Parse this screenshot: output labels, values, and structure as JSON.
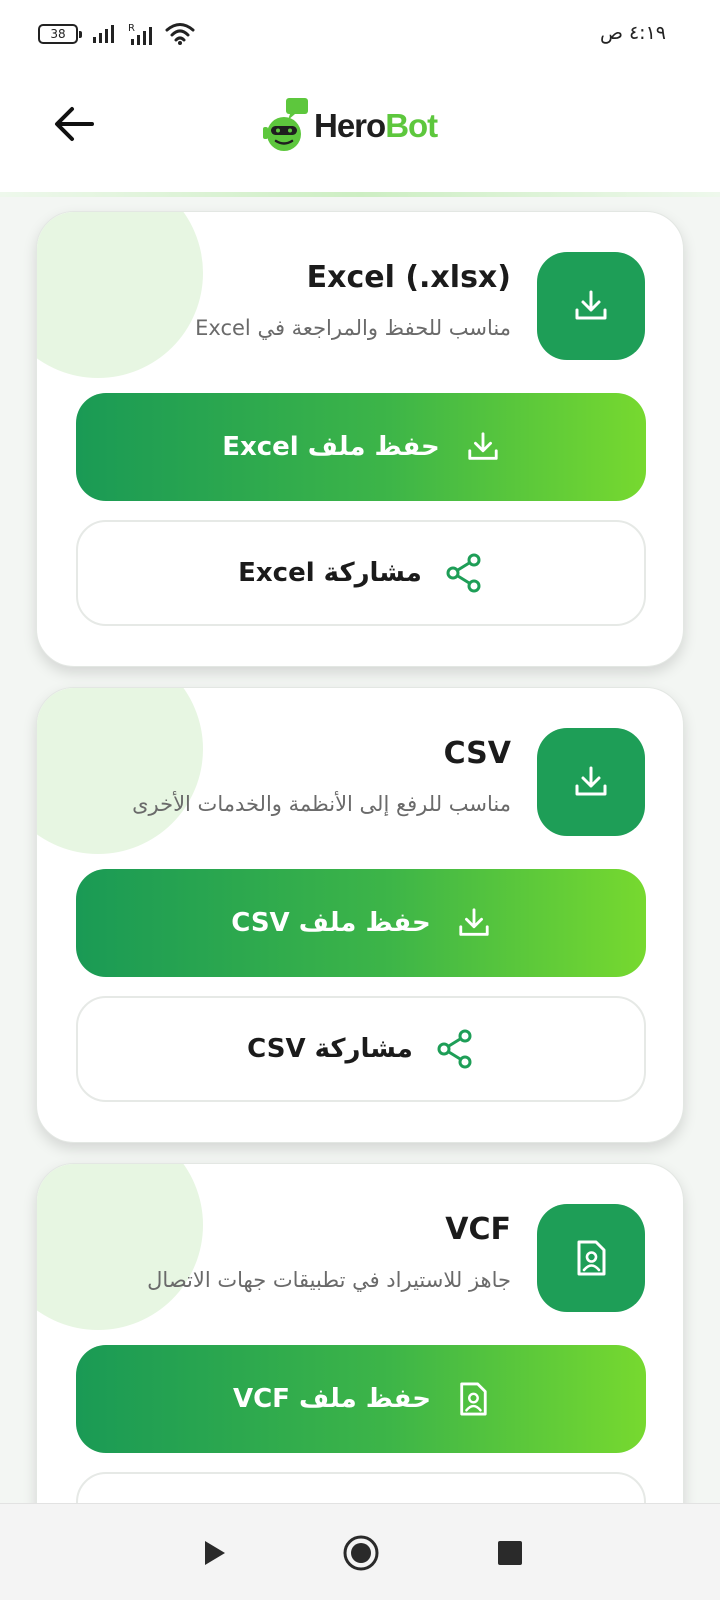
{
  "status_bar": {
    "battery_level": "38",
    "time": "٤:١٩ ص"
  },
  "header": {
    "logo": {
      "hero": "Hero",
      "bot": "Bot"
    }
  },
  "cards": [
    {
      "title": "Excel (.xlsx)",
      "description": "مناسب للحفظ والمراجعة في Excel",
      "icon": "download-icon",
      "save_label": "حفظ ملف Excel",
      "save_icon": "download-icon",
      "share_label": "مشاركة Excel",
      "share_icon": "share-icon"
    },
    {
      "title": "CSV",
      "description": "مناسب للرفع إلى الأنظمة والخدمات الأخرى",
      "icon": "download-icon",
      "save_label": "حفظ ملف CSV",
      "save_icon": "download-icon",
      "share_label": "مشاركة CSV",
      "share_icon": "share-icon"
    },
    {
      "title": "VCF",
      "description": "جاهز للاستيراد في تطبيقات جهات الاتصال",
      "icon": "contact-file-icon",
      "save_label": "حفظ ملف VCF",
      "save_icon": "contact-file-icon"
    }
  ],
  "colors": {
    "primary": "#1e9e57",
    "gradient_end": "#77d92f",
    "logo_green": "#5dc73d"
  }
}
